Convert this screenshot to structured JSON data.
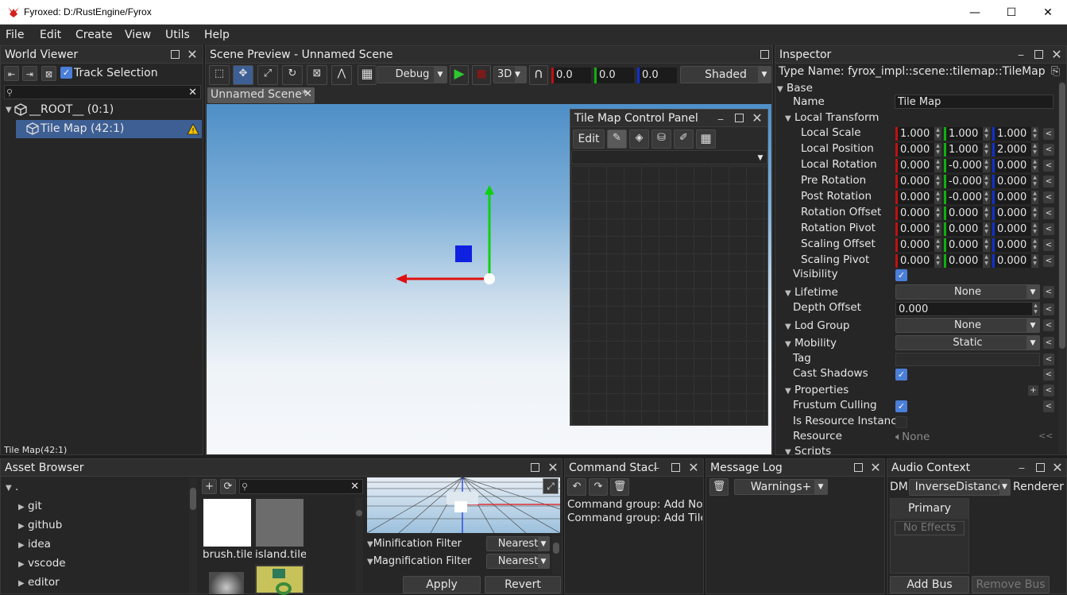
{
  "window": {
    "title": "Fyroxed: D:/RustEngine/Fyrox",
    "minimize": "—",
    "maximize": "☐",
    "close": "✕"
  },
  "menu": [
    "File",
    "Edit",
    "Create",
    "View",
    "Utils",
    "Help"
  ],
  "world_viewer": {
    "title": "World Viewer",
    "track_selection": "Track Selection",
    "search_placeholder": "",
    "tree": [
      {
        "label": "__ROOT__ (0:1)"
      },
      {
        "label": "Tile Map (42:1)",
        "selected": true,
        "warning": true
      }
    ],
    "status": "Tile Map(42:1)"
  },
  "scene_preview": {
    "title": "Scene Preview - Unnamed Scene",
    "debug_mode": "Debug",
    "projection": "3D",
    "snap_x": "0.0",
    "snap_y": "0.0",
    "snap_z": "0.0",
    "render_mode": "Shaded",
    "tab": "Unnamed Scene*",
    "tab_close": "✕"
  },
  "tile_map_panel": {
    "title": "Tile Map Control Panel",
    "edit": "Edit"
  },
  "inspector": {
    "title": "Inspector",
    "type_name": "Type Name: fyrox_impl::scene::tilemap::TileMap",
    "base": "Base",
    "name_label": "Name",
    "name_value": "Tile Map",
    "local_transform": "Local Transform",
    "vectors": [
      {
        "label": "Local Scale",
        "x": "1.000",
        "y": "1.000",
        "z": "1.000"
      },
      {
        "label": "Local Position",
        "x": "0.000",
        "y": "1.000",
        "z": "2.000"
      },
      {
        "label": "Local Rotation",
        "x": "0.000",
        "y": "-0.000",
        "z": "0.000"
      },
      {
        "label": "Pre Rotation",
        "x": "0.000",
        "y": "-0.000",
        "z": "0.000"
      },
      {
        "label": "Post Rotation",
        "x": "0.000",
        "y": "-0.000",
        "z": "0.000"
      },
      {
        "label": "Rotation Offset",
        "x": "0.000",
        "y": "0.000",
        "z": "0.000"
      },
      {
        "label": "Rotation Pivot",
        "x": "0.000",
        "y": "0.000",
        "z": "0.000"
      },
      {
        "label": "Scaling Offset",
        "x": "0.000",
        "y": "0.000",
        "z": "0.000"
      },
      {
        "label": "Scaling Pivot",
        "x": "0.000",
        "y": "0.000",
        "z": "0.000"
      }
    ],
    "visibility": "Visibility",
    "lifetime": "Lifetime",
    "lifetime_value": "None",
    "depth_offset": "Depth Offset",
    "depth_offset_value": "0.000",
    "lod_group": "Lod Group",
    "lod_group_value": "None",
    "mobility": "Mobility",
    "mobility_value": "Static",
    "tag": "Tag",
    "tag_value": "",
    "cast_shadows": "Cast Shadows",
    "properties": "Properties",
    "frustum_culling": "Frustum Culling",
    "is_resource_instance": "Is Resource Instanc",
    "resource": "Resource",
    "resource_value": "None",
    "scripts": "Scripts",
    "revert": "<",
    "revert_all": "<<",
    "add": "+"
  },
  "asset_browser": {
    "title": "Asset Browser",
    "root": ".",
    "folders": [
      "git",
      "github",
      "idea",
      "vscode",
      "editor"
    ],
    "assets": [
      {
        "label": "brush.tile_"
      },
      {
        "label": "island.tiles"
      }
    ],
    "minification_filter": "Minification Filter",
    "minification_value": "Nearest",
    "magnification_filter": "Magnification Filter",
    "magnification_value": "Nearest",
    "apply": "Apply",
    "revert": "Revert"
  },
  "command_stack": {
    "title": "Command Stacl",
    "entries": [
      "Command group: Add Nod",
      "Command group: Add Tile,"
    ]
  },
  "message_log": {
    "title": "Message Log",
    "filter": "Warnings+"
  },
  "audio_context": {
    "title": "Audio Context",
    "dm_label": "DM",
    "distance_model": "InverseDistance",
    "renderer": "Renderer",
    "bus_name": "Primary",
    "no_effects": "No Effects",
    "add_bus": "Add Bus",
    "remove_bus": "Remove Bus"
  },
  "colors": {
    "accent": "#4a7ed8",
    "selection": "#3d5f94",
    "x_axis": "#e01010",
    "y_axis": "#10d010",
    "z_axis": "#1030e0"
  }
}
